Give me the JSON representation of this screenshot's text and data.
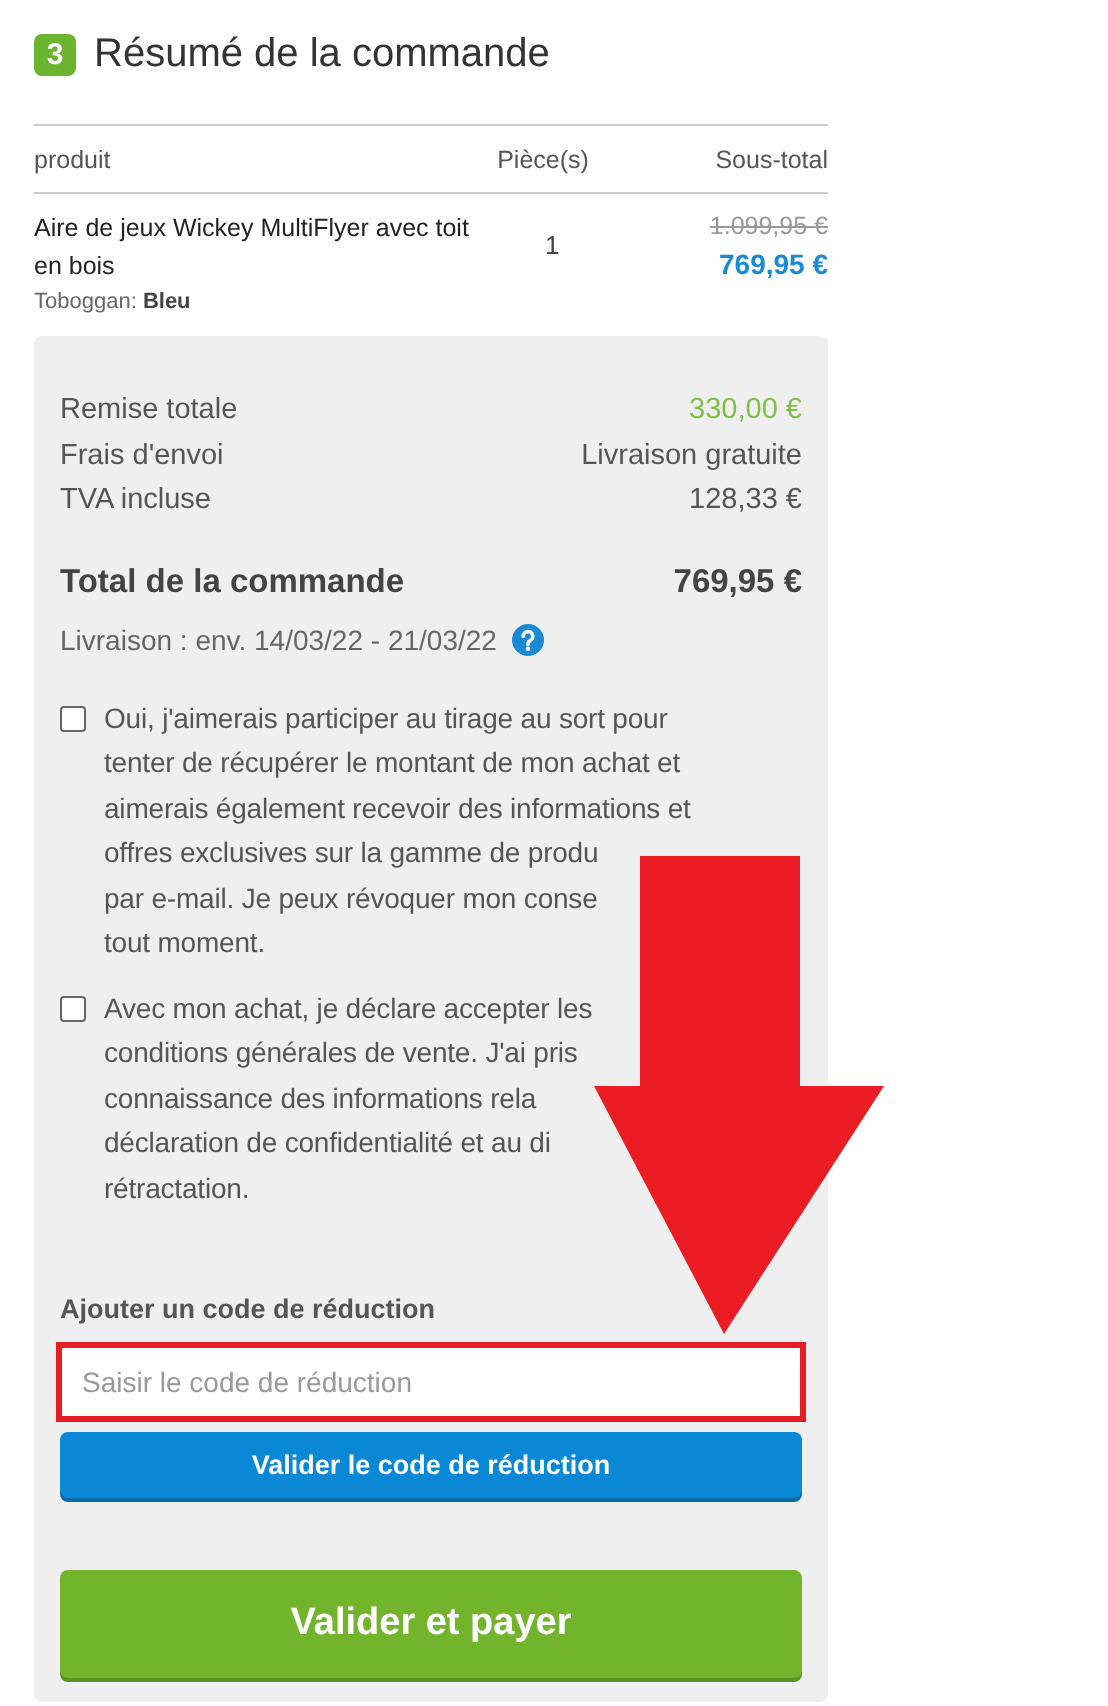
{
  "section": {
    "step": "3",
    "title": "Résumé de la commande"
  },
  "table": {
    "columns": [
      "produit",
      "Pièce(s)",
      "Sous-total"
    ],
    "rows": [
      {
        "product": "Aire de jeux Wickey MultiFlyer avec toit en bois",
        "option_label": "Toboggan:",
        "option_value": "Bleu",
        "quantity": "1",
        "old_price": "1.099,95 €",
        "price": "769,95 €"
      }
    ]
  },
  "summary": [
    {
      "label": "Remise totale",
      "value": "330,00 €",
      "kind": "discount"
    },
    {
      "label": "Frais d'envoi",
      "value": "Livraison gratuite",
      "kind": "plain"
    },
    {
      "label": "TVA incluse",
      "value": "128,33 €",
      "kind": "plain"
    }
  ],
  "total": {
    "label": "Total de la commande",
    "value": "769,95 €"
  },
  "delivery": "Livraison : env. 14/03/22 - 21/03/22",
  "consents": [
    {
      "text": "Oui, j'aimerais participer au tirage au sort pour\ntenter de récupérer le montant de mon achat et\naimerais également recevoir des informations et\noffres exclusives sur la gamme de produ\npar e-mail. Je peux révoquer mon conse\ntout moment.",
      "checked": false
    },
    {
      "text": "Avec mon achat, je déclare accepter les\nconditions générales de vente. J'ai pris\nconnaissance des informations rela\ndéclaration de confidentialité et au di\nrétractation.",
      "checked": false
    }
  ],
  "coupon": {
    "label": "Ajouter un code de réduction",
    "placeholder": "Saisir le code de réduction",
    "button": "Valider le code de réduction"
  },
  "submit": "Valider et payer"
}
